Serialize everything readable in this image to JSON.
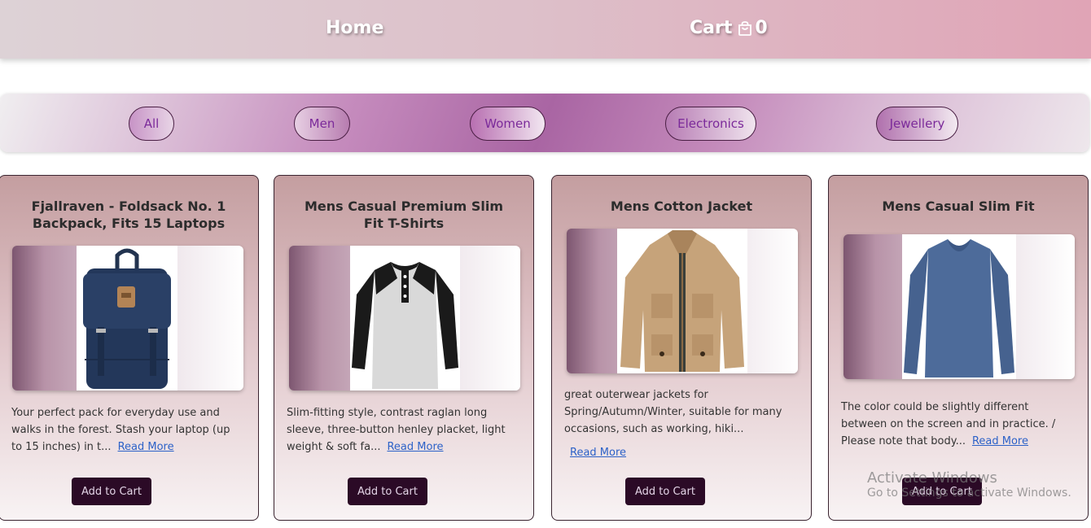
{
  "nav": {
    "home_label": "Home",
    "cart_label": "Cart",
    "cart_count": "0",
    "cart_icon": "shopping-bag-icon"
  },
  "filters": [
    {
      "label": "All"
    },
    {
      "label": "Men"
    },
    {
      "label": "Women"
    },
    {
      "label": "Electronics"
    },
    {
      "label": "Jewellery"
    }
  ],
  "products": [
    {
      "title": "Fjallraven - Foldsack No. 1 Backpack, Fits 15 Laptops",
      "description": "Your perfect pack for everyday use and walks in the forest. Stash your laptop (up to 15 inches) in t...",
      "read_more": "Read More",
      "add_to_cart": "Add to Cart",
      "image": "navy-backpack"
    },
    {
      "title": "Mens Casual Premium Slim Fit T-Shirts",
      "description": "Slim-fitting style, contrast raglan long sleeve, three-button henley placket, light weight & soft fa...",
      "read_more": "Read More",
      "add_to_cart": "Add to Cart",
      "image": "raglan-henley-shirt"
    },
    {
      "title": "Mens Cotton Jacket",
      "description": "great outerwear jackets for Spring/Autumn/Winter, suitable for many occasions, such as working, hiki...",
      "read_more": "Read More",
      "add_to_cart": "Add to Cart",
      "image": "khaki-jacket"
    },
    {
      "title": "Mens Casual Slim Fit",
      "description": "The color could be slightly different between on the screen and in practice. / Please note that body...",
      "read_more": "Read More",
      "add_to_cart": "Add to Cart",
      "image": "blue-long-sleeve-shirt"
    }
  ],
  "watermark": {
    "title": "Activate Windows",
    "subtitle": "Go to Settings to activate Windows."
  },
  "colors": {
    "button_bg": "#2b0a26",
    "link": "#2d62c8",
    "filter_text": "#7b2a9a"
  }
}
